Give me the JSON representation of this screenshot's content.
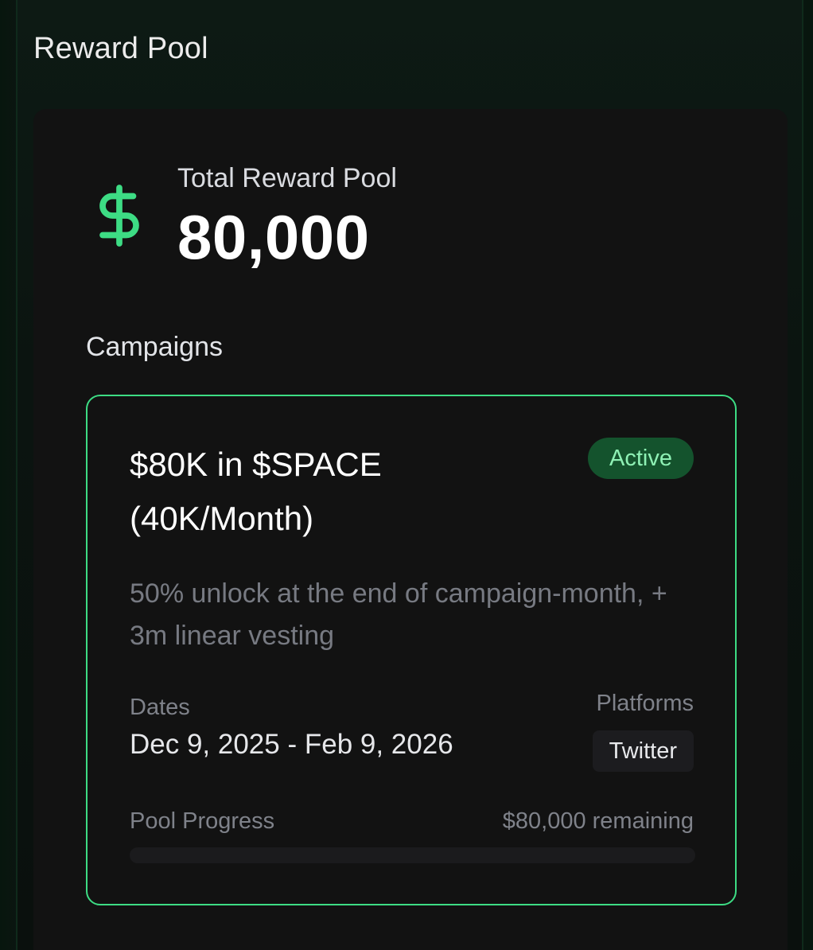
{
  "section": {
    "title": "Reward Pool"
  },
  "total": {
    "icon": "dollar-icon",
    "label": "Total Reward Pool",
    "value": "80,000"
  },
  "campaigns": {
    "label": "Campaigns",
    "items": [
      {
        "title": "$80K in $SPACE (40K/Month)",
        "status": "Active",
        "description": "50% unlock at the end of campaign-month, + 3m linear vesting",
        "dates_label": "Dates",
        "dates_value": "Dec 9, 2025 - Feb 9, 2026",
        "platforms_label": "Platforms",
        "platforms": [
          "Twitter"
        ],
        "progress_label": "Pool Progress",
        "remaining_text": "$80,000 remaining",
        "progress_fraction": 0
      }
    ]
  },
  "colors": {
    "accent": "#3ddc84",
    "badge_bg": "#14532d",
    "badge_text": "#8ef0b4",
    "card_bg": "#121212"
  }
}
